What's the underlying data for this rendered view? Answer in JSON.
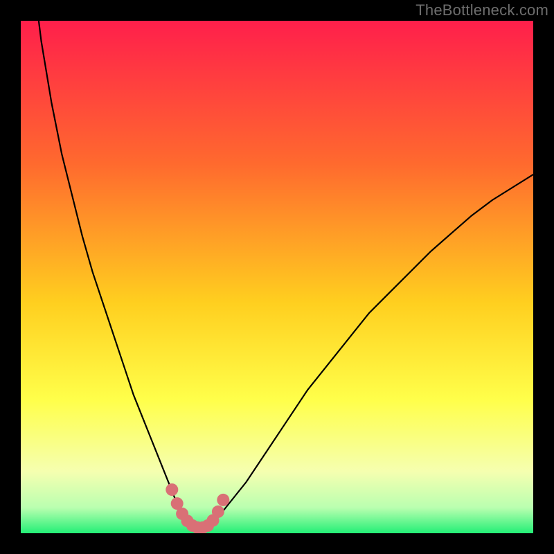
{
  "watermark": "TheBottleneck.com",
  "colors": {
    "frame": "#000000",
    "gradient_top": "#ff1f4b",
    "gradient_mid1": "#ff6a2e",
    "gradient_mid2": "#ffcf1f",
    "gradient_mid3": "#ffff4a",
    "gradient_mid4": "#f5ffb0",
    "gradient_bottom_band": "#baffb0",
    "gradient_bottom": "#23ef76",
    "curve": "#000000",
    "marker_fill": "#d97076",
    "marker_stroke": "#b35058"
  },
  "chart_data": {
    "type": "line",
    "title": "",
    "xlabel": "",
    "ylabel": "",
    "xlim": [
      0,
      100
    ],
    "ylim": [
      0,
      100
    ],
    "series": [
      {
        "name": "bottleneck-curve",
        "x": [
          0,
          2,
          4,
          6,
          8,
          10,
          12,
          14,
          16,
          18,
          20,
          22,
          24,
          26,
          28,
          30,
          31,
          32,
          33,
          34,
          35,
          36,
          37,
          38,
          40,
          44,
          48,
          52,
          56,
          60,
          64,
          68,
          72,
          76,
          80,
          84,
          88,
          92,
          96,
          100
        ],
        "values": [
          140,
          112,
          96,
          84,
          74,
          66,
          58,
          51,
          45,
          39,
          33,
          27,
          22,
          17,
          12,
          7,
          5,
          3.5,
          2.2,
          1.4,
          1.1,
          1.1,
          1.5,
          2.5,
          5,
          10,
          16,
          22,
          28,
          33,
          38,
          43,
          47,
          51,
          55,
          58.5,
          62,
          65,
          67.5,
          70
        ]
      }
    ],
    "markers": {
      "name": "highlight-dots",
      "x": [
        29.5,
        30.5,
        31.5,
        32.5,
        33.5,
        34.5,
        35.5,
        36.5,
        37.5,
        38.5,
        39.5
      ],
      "values": [
        8.5,
        5.8,
        3.8,
        2.4,
        1.5,
        1.1,
        1.1,
        1.5,
        2.5,
        4.2,
        6.5
      ]
    }
  }
}
